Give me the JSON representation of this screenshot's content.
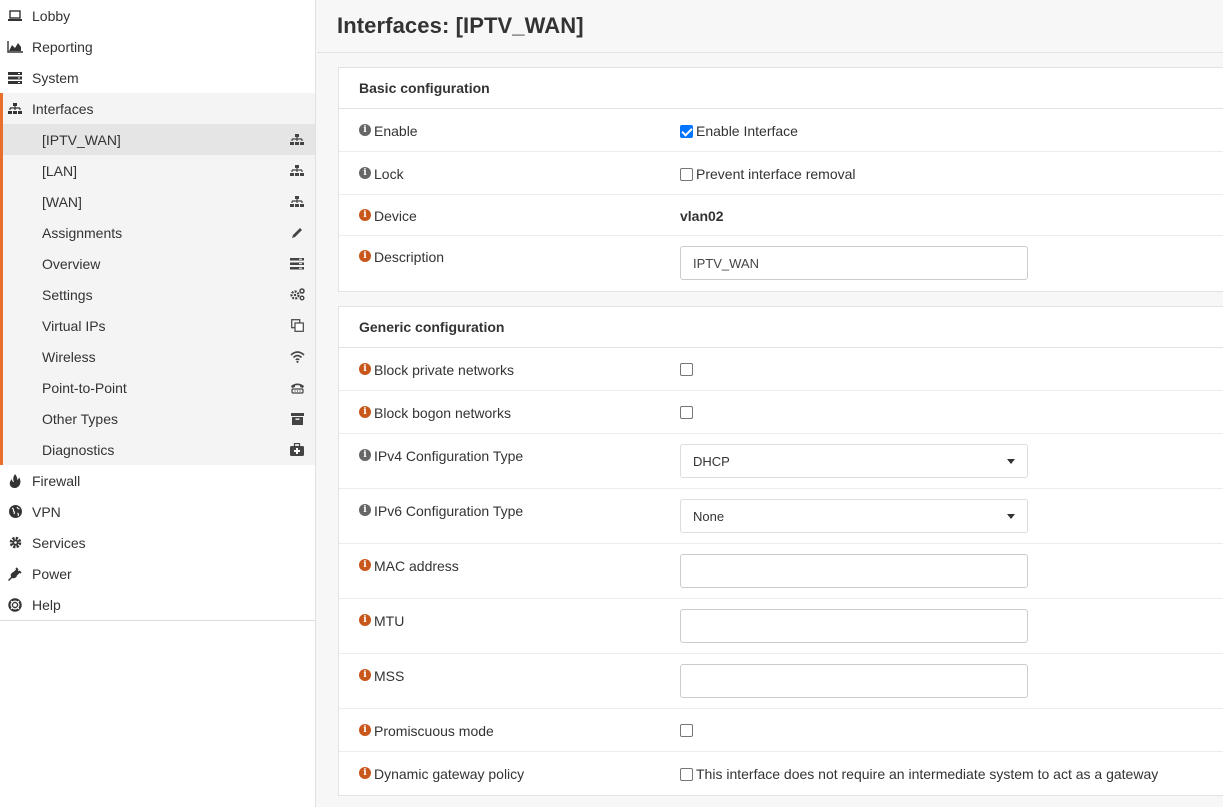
{
  "sidebar": {
    "top_items": [
      {
        "label": "Lobby",
        "icon": "laptop-icon"
      },
      {
        "label": "Reporting",
        "icon": "area-chart-icon"
      },
      {
        "label": "System",
        "icon": "server-icon"
      },
      {
        "label": "Interfaces",
        "icon": "sitemap-icon"
      }
    ],
    "interfaces_sub": [
      {
        "label": "[IPTV_WAN]",
        "icon": "sitemap-icon"
      },
      {
        "label": "[LAN]",
        "icon": "sitemap-icon"
      },
      {
        "label": "[WAN]",
        "icon": "sitemap-icon"
      },
      {
        "label": "Assignments",
        "icon": "pencil-icon"
      },
      {
        "label": "Overview",
        "icon": "list-icon"
      },
      {
        "label": "Settings",
        "icon": "cogs-icon"
      },
      {
        "label": "Virtual IPs",
        "icon": "clone-icon"
      },
      {
        "label": "Wireless",
        "icon": "wifi-icon"
      },
      {
        "label": "Point-to-Point",
        "icon": "phone-icon"
      },
      {
        "label": "Other Types",
        "icon": "archive-icon"
      },
      {
        "label": "Diagnostics",
        "icon": "medkit-icon"
      }
    ],
    "bottom_items": [
      {
        "label": "Firewall",
        "icon": "fire-icon"
      },
      {
        "label": "VPN",
        "icon": "globe-icon"
      },
      {
        "label": "Services",
        "icon": "cog-icon"
      },
      {
        "label": "Power",
        "icon": "plug-icon"
      },
      {
        "label": "Help",
        "icon": "life-ring-icon"
      }
    ]
  },
  "page": {
    "title": "Interfaces: [IPTV_WAN]"
  },
  "basic": {
    "heading": "Basic configuration",
    "enable_label": "Enable",
    "enable_value": "Enable Interface",
    "lock_label": "Lock",
    "lock_value": "Prevent interface removal",
    "device_label": "Device",
    "device_value": "vlan02",
    "description_label": "Description",
    "description_value": "IPTV_WAN"
  },
  "generic": {
    "heading": "Generic configuration",
    "block_private_label": "Block private networks",
    "block_bogon_label": "Block bogon networks",
    "ipv4_label": "IPv4 Configuration Type",
    "ipv4_value": "DHCP",
    "ipv6_label": "IPv6 Configuration Type",
    "ipv6_value": "None",
    "mac_label": "MAC address",
    "mtu_label": "MTU",
    "mss_label": "MSS",
    "promisc_label": "Promiscuous mode",
    "dyngw_label": "Dynamic gateway policy",
    "dyngw_value": "This interface does not require an intermediate system to act as a gateway"
  },
  "colors": {
    "accent": "#e8702a",
    "info_orange": "#c9571b",
    "checkbox_blue": "#0075ff"
  }
}
